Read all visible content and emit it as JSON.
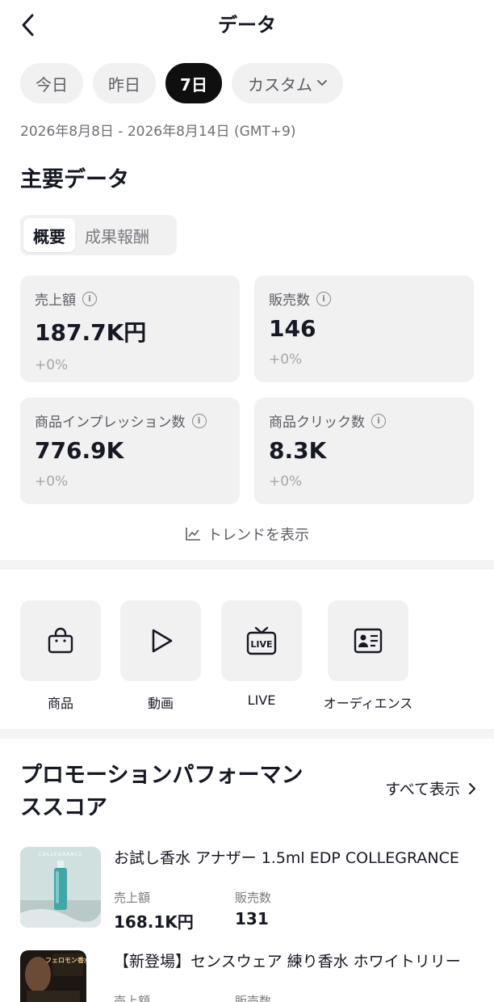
{
  "header": {
    "title": "データ"
  },
  "date_tabs": [
    {
      "label": "今日",
      "active": false
    },
    {
      "label": "昨日",
      "active": false
    },
    {
      "label": "7日",
      "active": true
    },
    {
      "label": "カスタム",
      "active": false
    }
  ],
  "date_range": "2026年8月8日 - 2026年8月14日 (GMT+9)",
  "key_data": {
    "title": "主要データ",
    "segments": [
      "概要",
      "成果報酬"
    ],
    "metrics": [
      {
        "label": "売上額",
        "value": "187.7K円",
        "change": "+0%"
      },
      {
        "label": "販売数",
        "value": "146",
        "change": "+0%"
      },
      {
        "label": "商品インプレッション数",
        "value": "776.9K",
        "change": "+0%"
      },
      {
        "label": "商品クリック数",
        "value": "8.3K",
        "change": "+0%"
      }
    ],
    "trend_link": "トレンドを表示"
  },
  "quick_links": [
    {
      "label": "商品",
      "icon": "shopping-bag-icon"
    },
    {
      "label": "動画",
      "icon": "play-icon"
    },
    {
      "label": "LIVE",
      "icon": "live-tv-icon"
    },
    {
      "label": "オーディエンス",
      "icon": "profile-card-icon"
    }
  ],
  "promotion": {
    "title_line1": "プロモーションパフォーマン",
    "title_line2": "ススコア",
    "see_all": "すべて表示",
    "products": [
      {
        "name": "お試し香水 アナザー 1.5ml EDP COLLEGRANCE",
        "thumb_text": "COLLEGRANCE",
        "sales_label": "売上額",
        "sales_value": "168.1K円",
        "units_label": "販売数",
        "units_value": "131"
      },
      {
        "name": "【新登場】センスウェア 練り香水 ホワイトリリー",
        "thumb_text": "フェロモン香水",
        "sales_label": "売上額",
        "sales_value": "",
        "units_label": "販売数",
        "units_value": ""
      }
    ]
  },
  "colors": {
    "accent": "#0f0f0f",
    "card_bg": "#f1f1f2",
    "muted": "#a6a6ab"
  }
}
